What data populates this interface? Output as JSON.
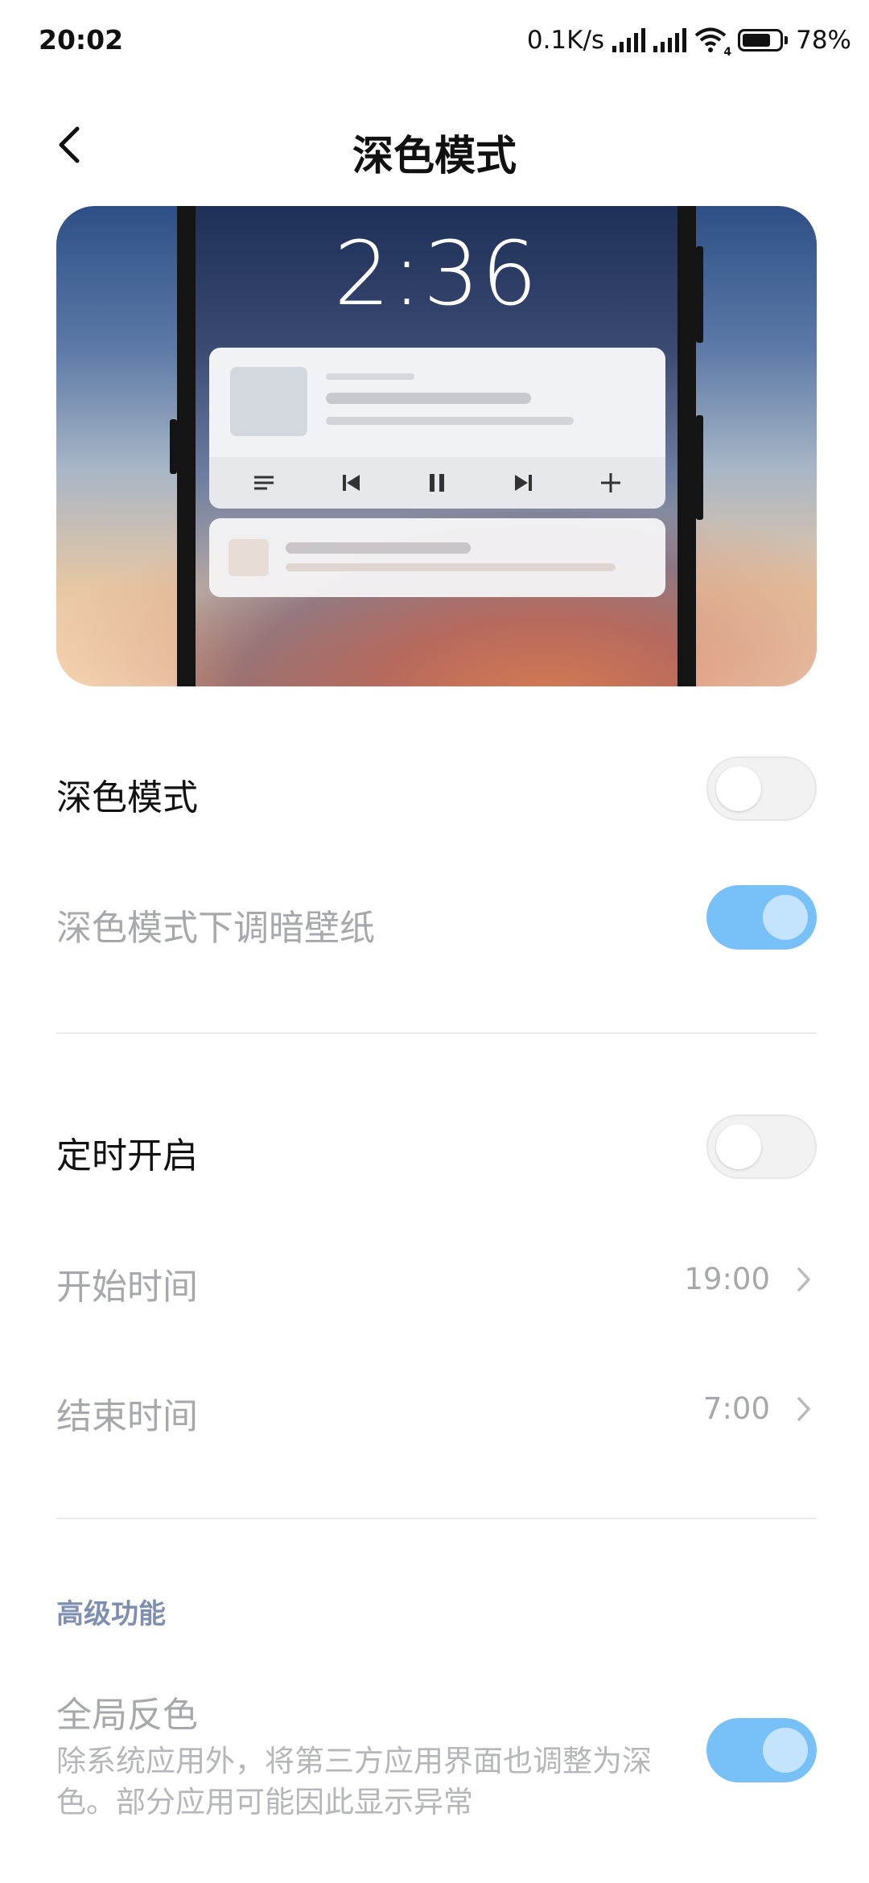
{
  "status_bar": {
    "time": "20:02",
    "net_speed": "0.1K/s",
    "wifi_badge": "4",
    "battery_percent": "78%",
    "battery_level": 0.78
  },
  "header": {
    "title": "深色模式",
    "back_icon": "chevron-left-icon"
  },
  "preview": {
    "clock": "2:36",
    "media_controls": [
      "list-icon",
      "previous-icon",
      "pause-icon",
      "next-icon",
      "plus-icon"
    ]
  },
  "settings": {
    "dark_mode": {
      "label": "深色模式",
      "enabled": false
    },
    "dim_wallpaper": {
      "label": "深色模式下调暗壁纸",
      "enabled": true
    },
    "schedule": {
      "label": "定时开启",
      "enabled": false
    },
    "start_time": {
      "label": "开始时间",
      "value": "19:00"
    },
    "end_time": {
      "label": "结束时间",
      "value": "7:00"
    },
    "advanced_section": "高级功能",
    "global_invert": {
      "label": "全局反色",
      "description": "除系统应用外，将第三方应用界面也调整为深色。部分应用可能因此显示异常",
      "enabled": true
    }
  },
  "colors": {
    "toggle_on": "#77c1f8",
    "section_header": "#7f8fb2",
    "disabled_text": "#a6a8ac"
  }
}
